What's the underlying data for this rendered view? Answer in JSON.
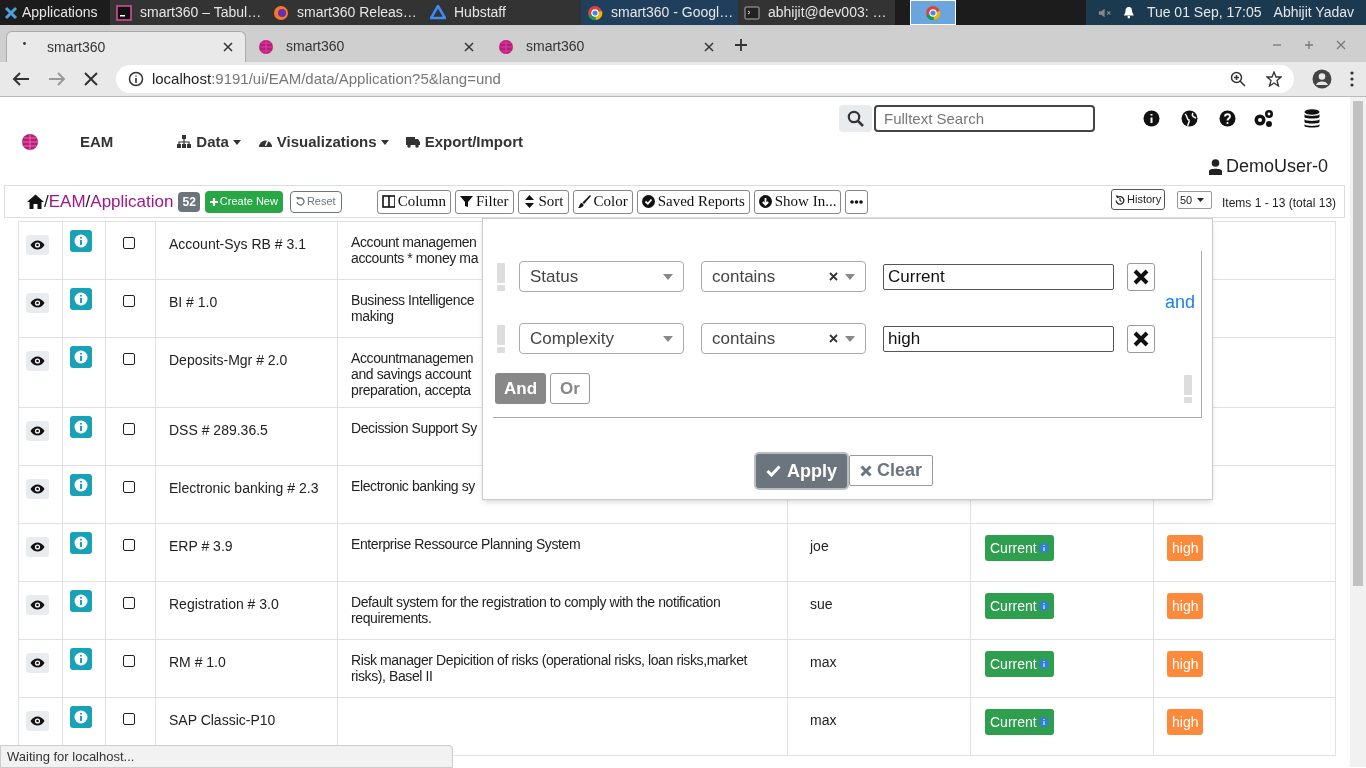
{
  "taskbar": {
    "apps_label": "Applications",
    "tasks": [
      {
        "label": "smart360 – Tabul…",
        "selected": false
      },
      {
        "label": "smart360 Releas…",
        "selected": false
      },
      {
        "label": "Hubstaff",
        "selected": false
      },
      {
        "label": "smart360 - Googl…",
        "selected": true
      },
      {
        "label": "abhijit@dev003: …",
        "selected": false
      },
      {
        "selected": true
      }
    ],
    "clock": "Tue 01 Sep, 17:05",
    "user": "Abhijit Yadav"
  },
  "browser": {
    "tabs": [
      {
        "title": "smart360",
        "selected": true,
        "loading": true
      },
      {
        "title": "smart360",
        "selected": false,
        "loading": false
      },
      {
        "title": "smart360",
        "selected": false,
        "loading": false
      }
    ],
    "url_host": "localhost",
    "url_rest": ":9191/ui/EAM/data/Application?5&lang=und"
  },
  "header": {
    "brand": "EAM",
    "nav": [
      {
        "label": "Data",
        "dropdown": true
      },
      {
        "label": "Visualizations",
        "dropdown": true
      },
      {
        "label": "Export/Import",
        "dropdown": false
      }
    ],
    "search_placeholder": "Fulltext Search",
    "user": "DemoUser-0"
  },
  "toolbar": {
    "breadcrumb": [
      {
        "separator": "/",
        "label": "EAM"
      },
      {
        "separator": "/",
        "label": "Application"
      }
    ],
    "count": "52",
    "create_label": "Create New",
    "reset_label": "Reset",
    "buttons": [
      {
        "label": "Column"
      },
      {
        "label": "Filter"
      },
      {
        "label": "Sort"
      },
      {
        "label": "Color"
      },
      {
        "label": "Saved Reports"
      },
      {
        "label": "Show In..."
      }
    ],
    "history_label": "History",
    "page_size": "50",
    "items_text": "Items 1 - 13 (total 13)"
  },
  "table": {
    "rows": [
      {
        "name": "Account-Sys RB # 3.1",
        "description": "Account managemen\naccounts * money ma",
        "checked": false
      },
      {
        "name": "BI # 1.0",
        "description": "Business Intelligence\nmaking",
        "checked": false
      },
      {
        "name": "Deposits-Mgr # 2.0",
        "description": "Accountmanagemen\nand savings account\npreparation, accepta",
        "checked": false
      },
      {
        "name": "DSS # 289.36.5",
        "description": "Decission Support Sy",
        "checked": false
      },
      {
        "name": "Electronic banking # 2.3",
        "description": "Electronic banking sy",
        "checked": false
      },
      {
        "name": "ERP # 3.9",
        "description": "Enterprise Ressource Planning System",
        "owner": "joe",
        "status": "Current",
        "complexity": "high",
        "checked": false
      },
      {
        "name": "Registration # 3.0",
        "description": "Default system for the registration to comply with the notification requirements.",
        "owner": "sue",
        "status": "Current",
        "complexity": "high",
        "checked": false
      },
      {
        "name": "RM # 1.0",
        "description": "Risk manager Depicition of risks (operational risks, loan risks,market risks), Basel II",
        "owner": "max",
        "status": "Current",
        "complexity": "high",
        "checked": false
      },
      {
        "name": "SAP Classic-P10",
        "owner": "max",
        "status": "Current",
        "complexity": "high",
        "checked": false
      }
    ]
  },
  "filter": {
    "conditions": [
      {
        "field": "Status",
        "operator": "contains",
        "value": "Current"
      },
      {
        "field": "Complexity",
        "operator": "contains",
        "value": "high"
      }
    ],
    "joiner": "and",
    "combinators": [
      {
        "label": "And",
        "selected": true
      },
      {
        "label": "Or",
        "selected": false
      }
    ],
    "apply_label": "Apply",
    "clear_label": "Clear"
  },
  "status_text": "Waiting for localhost..."
}
